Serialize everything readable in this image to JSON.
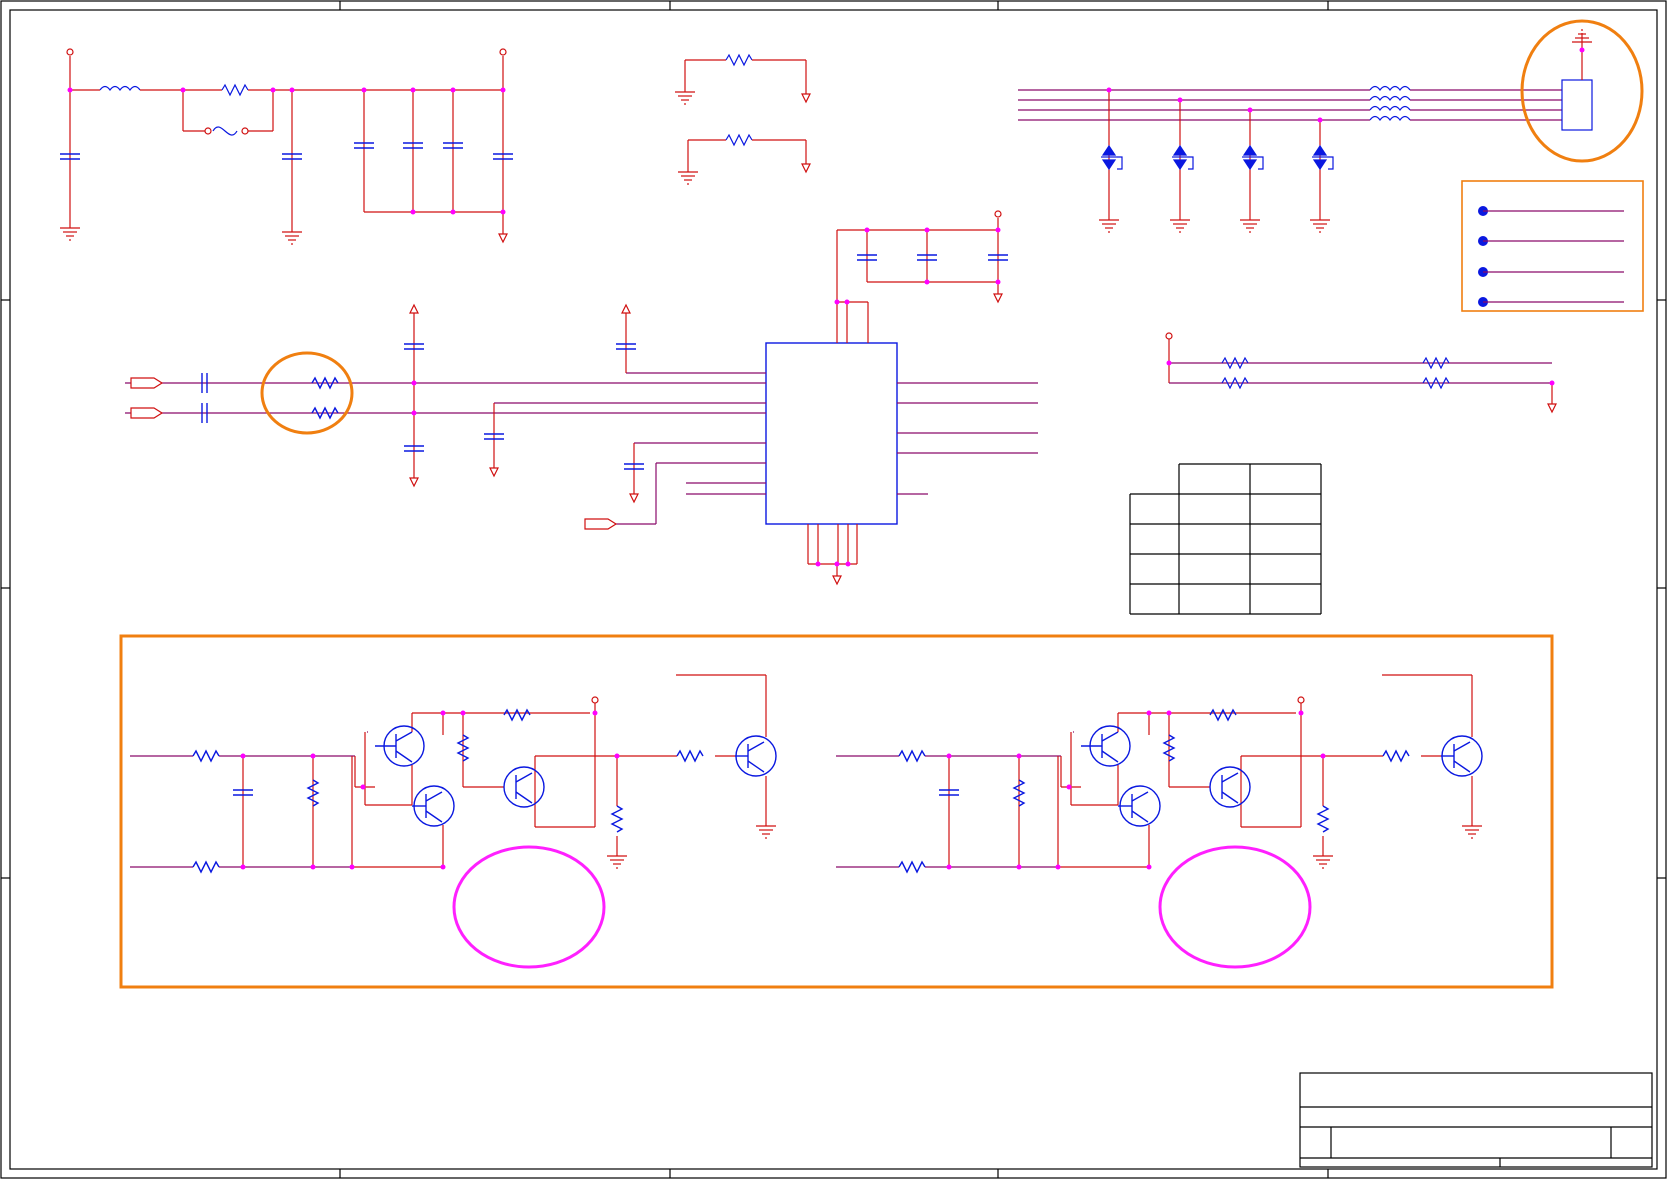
{
  "document": {
    "type": "schematic-sheet",
    "frame": {
      "zone_ticks_horizontal": 5,
      "zone_ticks_vertical": 4
    },
    "title_block": {
      "title": "",
      "size": "",
      "document_number": "",
      "revision": "",
      "date": "",
      "sheet": ""
    }
  },
  "colors": {
    "wire": "#d01010",
    "net": "#8a0a6a",
    "component": "#0a18e0",
    "junction": "#ff00ff",
    "highlight_orange": "#f07f10",
    "highlight_magenta": "#ff20ff",
    "frame": "#000000"
  },
  "legend": {
    "items": [
      "",
      "",
      "",
      ""
    ]
  },
  "table": {
    "header": [
      "",
      ""
    ],
    "rows": [
      [
        "",
        "",
        ""
      ],
      [
        "",
        "",
        ""
      ],
      [
        "",
        "",
        ""
      ],
      [
        "",
        "",
        ""
      ]
    ]
  },
  "blocks": [
    {
      "id": "power-input-filter"
    },
    {
      "id": "pull-down-resistors"
    },
    {
      "id": "connector-esd-protection"
    },
    {
      "id": "main-ic"
    },
    {
      "id": "resistor-network"
    },
    {
      "id": "transistor-driver-left"
    },
    {
      "id": "transistor-driver-right"
    }
  ]
}
